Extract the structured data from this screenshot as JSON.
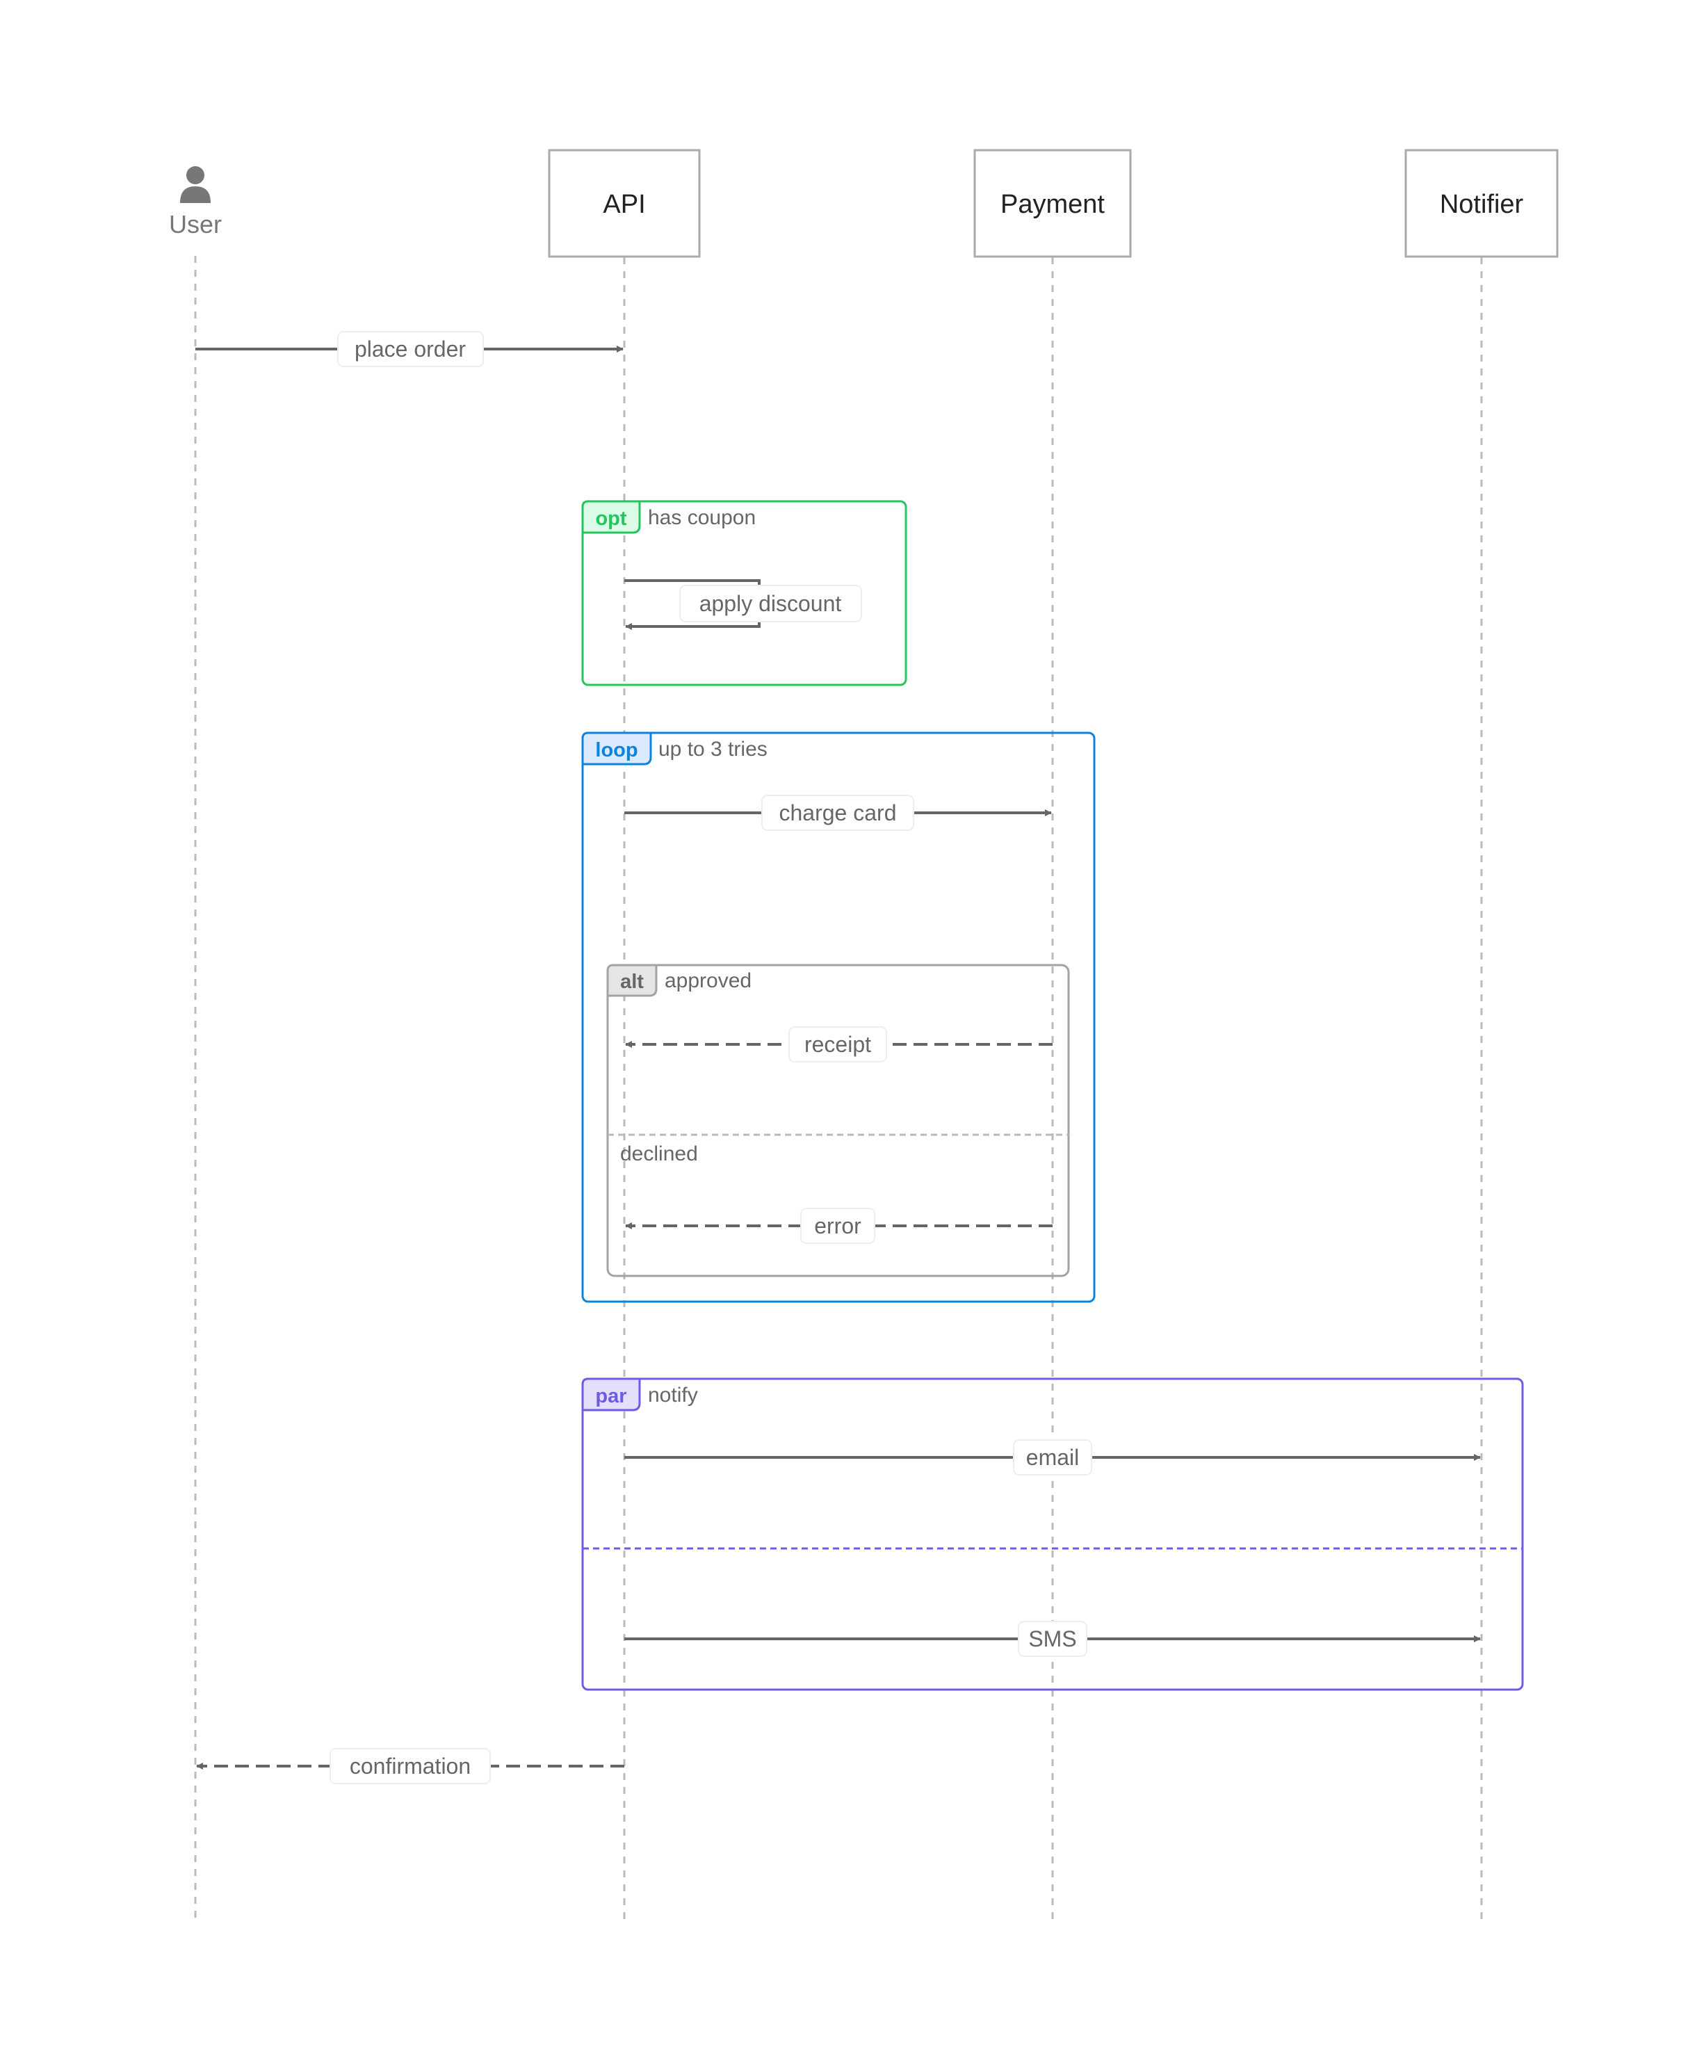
{
  "participants": [
    {
      "id": "user",
      "label": "User",
      "kind": "actor",
      "icon": "person-icon"
    },
    {
      "id": "api",
      "label": "API",
      "kind": "box"
    },
    {
      "id": "payment",
      "label": "Payment",
      "kind": "box"
    },
    {
      "id": "notifier",
      "label": "Notifier",
      "kind": "box"
    }
  ],
  "messages": [
    {
      "id": "m1",
      "from": "user",
      "to": "api",
      "label": "place order",
      "style": "solid"
    },
    {
      "id": "m2",
      "from": "api",
      "to": "api",
      "label": "apply discount",
      "style": "solid"
    },
    {
      "id": "m3",
      "from": "api",
      "to": "payment",
      "label": "charge card",
      "style": "solid"
    },
    {
      "id": "m4",
      "from": "payment",
      "to": "api",
      "label": "receipt",
      "style": "dashed"
    },
    {
      "id": "m5",
      "from": "payment",
      "to": "api",
      "label": "error",
      "style": "dashed"
    },
    {
      "id": "m6",
      "from": "api",
      "to": "notifier",
      "label": "email",
      "style": "solid"
    },
    {
      "id": "m7",
      "from": "api",
      "to": "notifier",
      "label": "SMS",
      "style": "solid"
    },
    {
      "id": "m8",
      "from": "api",
      "to": "user",
      "label": "confirmation",
      "style": "dashed"
    }
  ],
  "fragments": [
    {
      "id": "f-opt",
      "keyword": "opt",
      "condition": "has coupon",
      "color": "#22c55e",
      "tag_fill": "#dcfce7"
    },
    {
      "id": "f-loop",
      "keyword": "loop",
      "condition": "up to 3 tries",
      "color": "#0a84e0",
      "tag_fill": "#dbeafe"
    },
    {
      "id": "f-alt",
      "keyword": "alt",
      "condition": "approved",
      "else_condition": "declined",
      "color": "#a3a3a3",
      "tag_fill": "#e5e5e5"
    },
    {
      "id": "f-par",
      "keyword": "par",
      "condition": "notify",
      "color": "#6d5ce6",
      "tag_fill": "#e4e0fb"
    }
  ],
  "colors": {
    "arrow": "#666666",
    "lifeline": "#bbbbbb",
    "box_border": "#aaaaaa",
    "participant_text": "#222222",
    "label_text": "#666666",
    "actor": "#777777"
  }
}
